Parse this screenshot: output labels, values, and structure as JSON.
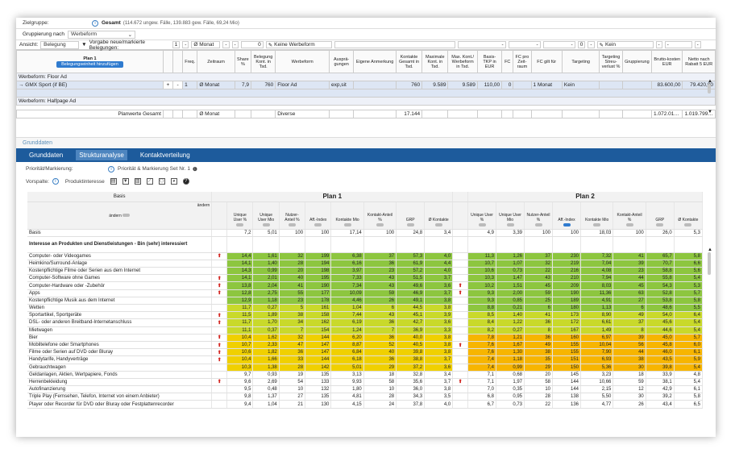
{
  "top": {
    "ziel_label": "Zielgruppe:",
    "ziel_name": "Gesamt",
    "ziel_detail": "(114.672 ungew. Fälle, 139.883 gew. Fälle, 69,24 Mio)",
    "grp_label": "Gruppierung nach",
    "grp_value": "Werbeform"
  },
  "ansicht": {
    "label": "Ansicht:",
    "value": "Belegung",
    "vorgabe": "Vorgabe neue/markierte Belegungen:",
    "n1": "1",
    "d1": "-",
    "monat": "Ø Monat",
    "d2": "-",
    "d3": "-",
    "zero": "0",
    "werbeform": "Keine Werbeform",
    "d4": "-",
    "d5": "-",
    "d6": "-",
    "zero2": "0",
    "d7": "-",
    "kein": "Kein",
    "d8": "-",
    "d9": "-",
    "d10": "-"
  },
  "plan_table": {
    "headers": [
      "Plan 1",
      "",
      "",
      "Freq.",
      "Zeitraum",
      "Share %",
      "Belegung Kont. in Tsd.",
      "Werbeform",
      "Ausprä-gungen",
      "Eigene Anmerkung",
      "Kontakte Gesamt in Tsd.",
      "Maximale Kont. in Tsd.",
      "Max. Kont./ Werbeform in Tsd.",
      "Basis-TKP in EUR",
      "FC",
      "FC pro Zeit-raum",
      "FC gilt für",
      "Targeting",
      "Targeting Streu-verlust %",
      "Gruppierung",
      "Brutto-kosten EUR",
      "Netto nach Rabatt 5 EUR"
    ],
    "add_button": "Belegungseinheit hinzufügen",
    "sec1": "Werbeform: Floor Ad",
    "row1": [
      "→ GMX Sport (if BE)",
      "+",
      "-",
      "1",
      "Ø Monat",
      "7,9",
      "760",
      "Floor Ad",
      "exp,sit",
      "",
      "760",
      "9.589",
      "9.589",
      "110,00",
      "0",
      "",
      "1 Monat",
      "Kein",
      "",
      "",
      "83.600,00",
      "79.420,00"
    ],
    "sec2": "Werbeform: Halfpage Ad",
    "total": [
      "Planwerte Gesamt",
      "Ø Monat",
      "Diverse",
      "17.144",
      "1.072.010,00",
      "1.019.799,38"
    ]
  },
  "subtitle": "Grunddaten",
  "tabs": [
    "Grunddaten",
    "Strukturanalyse",
    "Kontaktverteilung"
  ],
  "prio": {
    "label": "Priorität/Markierung:",
    "value": "Priorität & Markierung Set Nr. 1"
  },
  "vorspalte": {
    "label": "Vorspalte:",
    "value": "Produktinteresse"
  },
  "sa": {
    "basis_label": "Basis",
    "aendern1": "ändern",
    "aendern2": "ändern",
    "plan1": "Plan 1",
    "plan2": "Plan 2",
    "cols": [
      "Unique User %",
      "Unique User Mio",
      "Nutzer-Anteil %",
      "Aff.-Index",
      "Kontakte Mio",
      "Kontakt-Anteil %",
      "GRP",
      "Ø Kontakte"
    ],
    "basis_row": [
      "Basis",
      "7,2",
      "5,01",
      "100",
      "100",
      "17,14",
      "100",
      "24,8",
      "3,4",
      "4,9",
      "3,39",
      "100",
      "100",
      "18,03",
      "100",
      "26,0",
      "5,3"
    ],
    "section": "Interesse an Produkten und Dienstleistungen - Bin (sehr) interessiert",
    "rows": [
      [
        "Computer- oder Videogames",
        "up",
        "14,4",
        "1,61",
        "32",
        "199",
        "6,38",
        "37",
        "57,3",
        "4,0",
        "",
        "11,3",
        "1,26",
        "37",
        "230",
        "7,32",
        "41",
        "65,7",
        "5,8"
      ],
      [
        "Heimkino/Surround-Anlage",
        "",
        "14,1",
        "1,40",
        "28",
        "194",
        "6,16",
        "36",
        "61,9",
        "4,4",
        "",
        "10,7",
        "1,07",
        "32",
        "219",
        "7,04",
        "39",
        "70,7",
        "6,6"
      ],
      [
        "Kostenpflichtige Filme oder Serien aus dem Internet",
        "",
        "14,3",
        "0,99",
        "20",
        "198",
        "3,97",
        "23",
        "57,2",
        "4,0",
        "",
        "10,6",
        "0,73",
        "22",
        "216",
        "4,08",
        "23",
        "58,8",
        "5,6"
      ],
      [
        "Computer-Software ohne Games",
        "up",
        "14,1",
        "2,01",
        "40",
        "195",
        "7,33",
        "43",
        "51,5",
        "3,7",
        "",
        "10,3",
        "1,47",
        "43",
        "210",
        "7,94",
        "44",
        "55,8",
        "5,4"
      ],
      [
        "Computer-Hardware oder -Zubehör",
        "up",
        "13,8",
        "2,04",
        "41",
        "190",
        "7,34",
        "43",
        "49,6",
        "3,6",
        "up",
        "10,2",
        "1,51",
        "45",
        "209",
        "8,03",
        "45",
        "54,3",
        "5,3"
      ],
      [
        "Apps",
        "up",
        "12,8",
        "2,75",
        "55",
        "177",
        "10,09",
        "59",
        "46,9",
        "3,7",
        "up",
        "9,3",
        "2,00",
        "59",
        "190",
        "11,36",
        "63",
        "52,8",
        "5,7"
      ],
      [
        "Kostenpflichtige Musik aus dem Internet",
        "",
        "12,9",
        "1,18",
        "23",
        "178",
        "4,46",
        "26",
        "49,1",
        "3,8",
        "",
        "9,3",
        "0,85",
        "25",
        "189",
        "4,91",
        "27",
        "53,8",
        "5,8"
      ],
      [
        "Wetten",
        "",
        "11,7",
        "0,27",
        "5",
        "161",
        "1,04",
        "6",
        "44,5",
        "3,8",
        "",
        "8,8",
        "0,21",
        "6",
        "180",
        "1,13",
        "6",
        "48,6",
        "5,5"
      ],
      [
        "Sportartikel, Sportgeräte",
        "up",
        "11,5",
        "1,89",
        "38",
        "158",
        "7,44",
        "43",
        "45,1",
        "3,9",
        "",
        "8,5",
        "1,40",
        "41",
        "173",
        "8,90",
        "49",
        "54,0",
        "6,4"
      ],
      [
        "DSL- oder anderen Breitband-Internetanschluss",
        "up",
        "11,7",
        "1,70",
        "34",
        "162",
        "6,19",
        "36",
        "42,7",
        "3,6",
        "",
        "8,4",
        "1,22",
        "36",
        "172",
        "6,61",
        "37",
        "45,6",
        "5,4"
      ],
      [
        "Mietwagen",
        "",
        "11,1",
        "0,37",
        "7",
        "154",
        "1,24",
        "7",
        "36,9",
        "3,3",
        "",
        "8,2",
        "0,27",
        "8",
        "167",
        "1,49",
        "8",
        "44,6",
        "5,4"
      ],
      [
        "Bier",
        "up",
        "10,4",
        "1,62",
        "32",
        "144",
        "6,20",
        "36",
        "40,0",
        "3,8",
        "",
        "7,8",
        "1,21",
        "36",
        "160",
        "6,97",
        "39",
        "45,0",
        "5,7"
      ],
      [
        "Mobiltelefone oder Smartphones",
        "up",
        "10,7",
        "2,33",
        "47",
        "147",
        "8,87",
        "52",
        "40,5",
        "3,8",
        "up",
        "7,6",
        "1,67",
        "49",
        "155",
        "10,04",
        "56",
        "45,8",
        "6,0"
      ],
      [
        "Filme oder Serien auf DVD oder Bluray",
        "up",
        "10,6",
        "1,82",
        "36",
        "147",
        "6,84",
        "40",
        "39,8",
        "3,8",
        "",
        "7,6",
        "1,30",
        "38",
        "155",
        "7,90",
        "44",
        "46,0",
        "6,1"
      ],
      [
        "Handytarife, Handyverträge",
        "up",
        "10,4",
        "1,66",
        "33",
        "144",
        "6,18",
        "36",
        "38,8",
        "3,7",
        "",
        "7,4",
        "1,18",
        "35",
        "151",
        "6,93",
        "38",
        "43,5",
        "5,9"
      ],
      [
        "Gebrauchtwagen",
        "",
        "10,3",
        "1,38",
        "28",
        "142",
        "5,01",
        "29",
        "37,2",
        "3,6",
        "",
        "7,4",
        "0,99",
        "29",
        "150",
        "5,36",
        "30",
        "39,8",
        "5,4"
      ],
      [
        "Geldanlagen, Aktien, Wertpapiere, Fonds",
        "",
        "9,7",
        "0,93",
        "19",
        "135",
        "3,13",
        "18",
        "32,8",
        "3,4",
        "",
        "7,1",
        "0,68",
        "20",
        "145",
        "3,23",
        "18",
        "33,9",
        "4,8"
      ],
      [
        "Herrenbekleidung",
        "up",
        "9,6",
        "2,69",
        "54",
        "133",
        "9,93",
        "58",
        "35,6",
        "3,7",
        "up",
        "7,1",
        "1,97",
        "58",
        "144",
        "10,66",
        "59",
        "38,1",
        "5,4"
      ],
      [
        "Autofinanzierung",
        "",
        "9,5",
        "0,48",
        "10",
        "132",
        "1,80",
        "10",
        "36,0",
        "3,8",
        "",
        "7,0",
        "0,35",
        "10",
        "144",
        "2,15",
        "12",
        "42,9",
        "6,1"
      ],
      [
        "Triple Play (Fernsehen, Telefon, Internet von einem Anbieter)",
        "",
        "9,8",
        "1,37",
        "27",
        "135",
        "4,81",
        "28",
        "34,3",
        "3,5",
        "",
        "6,8",
        "0,95",
        "28",
        "138",
        "5,50",
        "30",
        "39,2",
        "5,8"
      ],
      [
        "Player oder Recorder für DVD oder Bluray oder Festplattenrecorder",
        "",
        "9,4",
        "1,04",
        "21",
        "130",
        "4,15",
        "24",
        "37,8",
        "4,0",
        "",
        "6,7",
        "0,73",
        "22",
        "136",
        "4,77",
        "26",
        "43,4",
        "6,5"
      ]
    ],
    "colors": {
      "green": "#8dc63f",
      "ygreen": "#c9d92b",
      "yellow": "#f0d000",
      "orange": "#f7b500"
    }
  }
}
